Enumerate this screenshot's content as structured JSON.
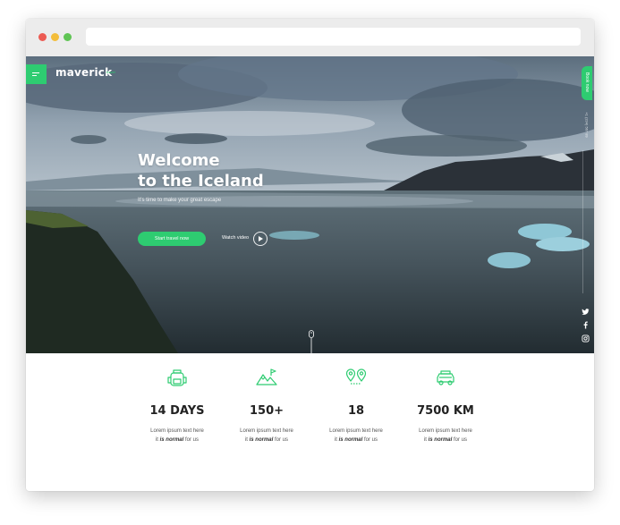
{
  "hero": {
    "logo": "maverick",
    "logo_sub": "travel",
    "title_line1": "Welcome",
    "title_line2": "to the Iceland",
    "subtitle": "It's time to make your great escape",
    "cta_label": "Start travel now",
    "watch_label": "Watch video",
    "book_label": "Book now",
    "phone": "+1 (234) 567 89",
    "social_icons": [
      "twitter-icon",
      "facebook-icon",
      "instagram-icon"
    ]
  },
  "stats": [
    {
      "icon": "backpack-icon",
      "value": "14 DAYS",
      "line1": "Lorem ipsum text here",
      "pre": "it ",
      "em": "is normal",
      "post": " for us"
    },
    {
      "icon": "mountains-icon",
      "value": "150+",
      "line1": "Lorem ipsum text here",
      "pre": "it ",
      "em": "is normal",
      "post": " for us"
    },
    {
      "icon": "map-pins-icon",
      "value": "18",
      "line1": "Lorem ipsum text here",
      "pre": "it ",
      "em": "is normal",
      "post": " for us"
    },
    {
      "icon": "car-icon",
      "value": "7500 KM",
      "line1": "Lorem ipsum text here",
      "pre": "it ",
      "em": "is normal",
      "post": " for us"
    }
  ],
  "colors": {
    "accent": "#2ecc71",
    "text_dark": "#222222",
    "text_muted": "#555555"
  }
}
